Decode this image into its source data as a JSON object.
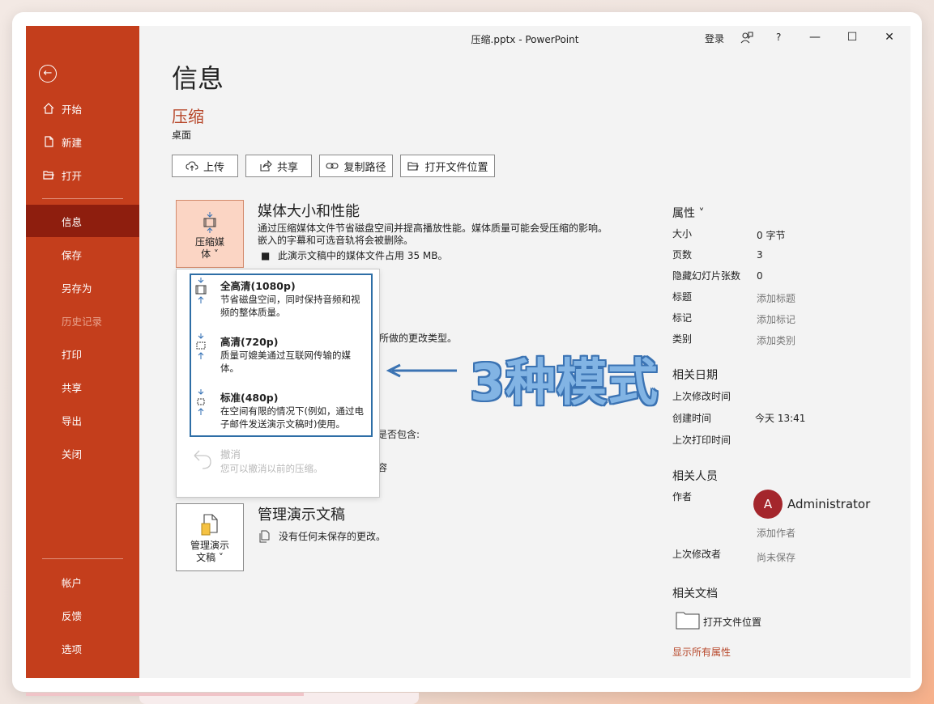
{
  "titlebar": {
    "title": "压缩.pptx  -  PowerPoint",
    "login": "登录",
    "help": "?"
  },
  "sidebar": {
    "items": [
      {
        "label": "开始",
        "icon": "home-icon"
      },
      {
        "label": "新建",
        "icon": "new-file-icon"
      },
      {
        "label": "打开",
        "icon": "open-folder-icon"
      },
      {
        "label": "信息",
        "active": true
      },
      {
        "label": "保存"
      },
      {
        "label": "另存为"
      },
      {
        "label": "历史记录",
        "disabled": true
      },
      {
        "label": "打印"
      },
      {
        "label": "共享"
      },
      {
        "label": "导出"
      },
      {
        "label": "关闭"
      },
      {
        "label": "帐户"
      },
      {
        "label": "反馈"
      },
      {
        "label": "选项"
      }
    ]
  },
  "main": {
    "heading": "信息",
    "file_name": "压缩",
    "file_location": "桌面",
    "buttons": {
      "upload": "上传",
      "share": "共享",
      "copy_path": "复制路径",
      "open_location": "打开文件位置"
    },
    "media": {
      "tile_label_1": "压缩媒",
      "tile_label_2": "体 ˅",
      "title": "媒体大小和性能",
      "desc_1": "通过压缩媒体文件节省磁盘空间并提高播放性能。媒体质量可能会受压缩的影响。",
      "desc_2": "嵌入的字幕和可选音轨将会被删除。",
      "bullet": "此演示文稿中的媒体文件占用 35 MB。"
    },
    "hidden_text": {
      "partial_1": "稿所做的更改类型。",
      "partial_2": "是否包含:",
      "partial_3": "容"
    },
    "dropdown": {
      "options": [
        {
          "title": "全高清(1080p)",
          "desc": "节省磁盘空间，同时保持音频和视频的整体质量。"
        },
        {
          "title": "高清(720p)",
          "desc": "质量可媲美通过互联网传输的媒体。"
        },
        {
          "title": "标准(480p)",
          "desc": "在空间有限的情况下(例如，通过电子邮件发送演示文稿时)使用。"
        }
      ],
      "undo_title": "撤消",
      "undo_desc": "您可以撤消以前的压缩。"
    },
    "manage": {
      "tile_label_1": "管理演示",
      "tile_label_2": "文稿 ˅",
      "title": "管理演示文稿",
      "desc": "没有任何未保存的更改。"
    }
  },
  "annotation": "3种模式",
  "properties": {
    "title": "属性 ˅",
    "rows": [
      {
        "label": "大小",
        "value": "0 字节",
        "link": false
      },
      {
        "label": "页数",
        "value": "3",
        "link": false
      },
      {
        "label": "隐藏幻灯片张数",
        "value": "0",
        "link": false
      },
      {
        "label": "标题",
        "value": "添加标题",
        "link": true
      },
      {
        "label": "标记",
        "value": "添加标记",
        "link": true
      },
      {
        "label": "类别",
        "value": "添加类别",
        "link": true
      }
    ],
    "dates_title": "相关日期",
    "dates": [
      {
        "label": "上次修改时间",
        "value": ""
      },
      {
        "label": "创建时间",
        "value": "今天 13:41"
      },
      {
        "label": "上次打印时间",
        "value": ""
      }
    ],
    "people_title": "相关人员",
    "author_label": "作者",
    "author_initial": "A",
    "author_name": "Administrator",
    "add_author": "添加作者",
    "last_modified_by_label": "上次修改者",
    "last_modified_by": "尚未保存",
    "docs_title": "相关文档",
    "open_location": "打开文件位置",
    "show_all": "显示所有属性"
  },
  "colors": {
    "sidebar": "#c43e1c",
    "sidebar_active": "#8e1e0e",
    "accent": "#b7472a",
    "annotation": "#82b4e4",
    "highlight_border": "#2e6ea6"
  }
}
